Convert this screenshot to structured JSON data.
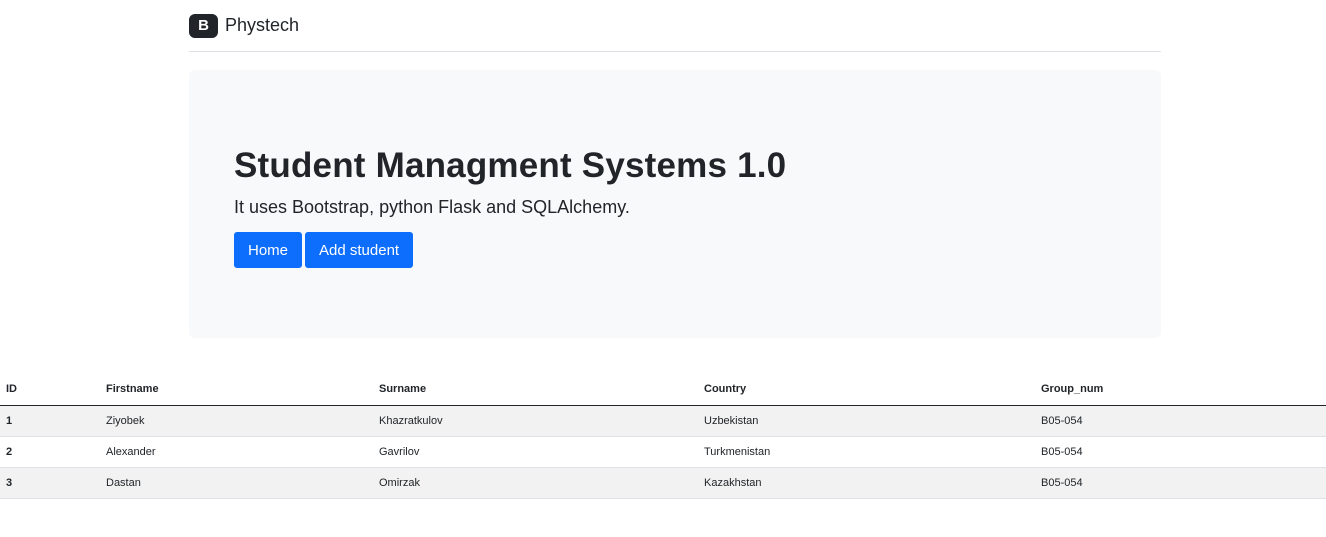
{
  "header": {
    "logo_letter": "B",
    "brand": "Phystech"
  },
  "hero": {
    "title": "Student Managment Systems 1.0",
    "lead": "It uses Bootstrap, python Flask and SQLAlchemy.",
    "buttons": {
      "home": "Home",
      "add": "Add student"
    }
  },
  "table": {
    "columns": [
      "ID",
      "Firstname",
      "Surname",
      "Country",
      "Group_num"
    ],
    "rows": [
      [
        "1",
        "Ziyobek",
        "Khazratkulov",
        "Uzbekistan",
        "B05-054"
      ],
      [
        "2",
        "Alexander",
        "Gavrilov",
        "Turkmenistan",
        "B05-054"
      ],
      [
        "3",
        "Dastan",
        "Omirzak",
        "Kazakhstan",
        "B05-054"
      ]
    ]
  },
  "colors": {
    "primary": "#0d6efd",
    "dark": "#212529",
    "jumbotron_bg": "#f8f9fa",
    "stripe": "#f2f2f2"
  }
}
